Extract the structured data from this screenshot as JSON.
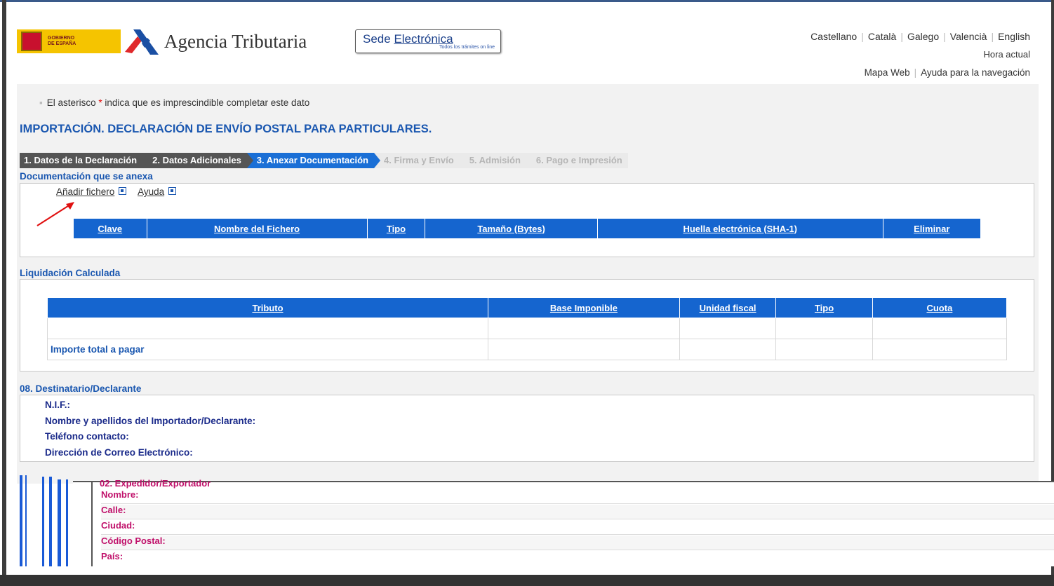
{
  "header": {
    "gobierno": "GOBIERNO\nDE ESPAÑA",
    "agency_name": "Agencia Tributaria",
    "sede_title_a": "Sede ",
    "sede_title_b": "Electrónica",
    "sede_subtitle": "Todos los trámites on line",
    "languages": [
      "Castellano",
      "Català",
      "Galego",
      "Valencià",
      "English"
    ],
    "hora_actual": "Hora actual",
    "mapa_web": "Mapa Web",
    "ayuda_navegacion": "Ayuda para la navegación"
  },
  "note": {
    "pre": "El asterisco ",
    "star": "*",
    "post": " indica que es imprescindible completar este dato"
  },
  "title": "IMPORTACIÓN. DECLARACIÓN DE ENVÍO POSTAL PARA PARTICULARES.",
  "steps": [
    {
      "label": "1. Datos de la Declaración",
      "state": "done"
    },
    {
      "label": "2. Datos Adicionales",
      "state": "done"
    },
    {
      "label": "3. Anexar Documentación",
      "state": "active"
    },
    {
      "label": "4. Firma y Envío",
      "state": "pending"
    },
    {
      "label": "5. Admisión",
      "state": "pending"
    },
    {
      "label": "6. Pago e Impresión",
      "state": "pending"
    }
  ],
  "documentation": {
    "section_title": "Documentación que se anexa",
    "add_file": "Añadir fichero",
    "help": "Ayuda",
    "columns": [
      "Clave",
      "Nombre del Fichero",
      "Tipo",
      "Tamaño (Bytes)",
      "Huella electrónica (SHA-1)",
      "Eliminar"
    ]
  },
  "liquidacion": {
    "section_title": "Liquidación Calculada",
    "columns": [
      "Tributo",
      "Base Imponible",
      "Unidad fiscal",
      "Tipo",
      "Cuota"
    ],
    "total_label": "Importe total a pagar"
  },
  "destinatario": {
    "section_title": "08. Destinatario/Declarante",
    "fields": [
      "N.I.F.:",
      "Nombre y apellidos del Importador/Declarante:",
      "Teléfono contacto:",
      "Dirección de Correo Electrónico:"
    ]
  },
  "expedidor": {
    "section_title": "02. Expedidor/Exportador",
    "fields": [
      "Nombre:",
      "Calle:",
      "Ciudad:",
      "Código Postal:",
      "País:"
    ]
  }
}
